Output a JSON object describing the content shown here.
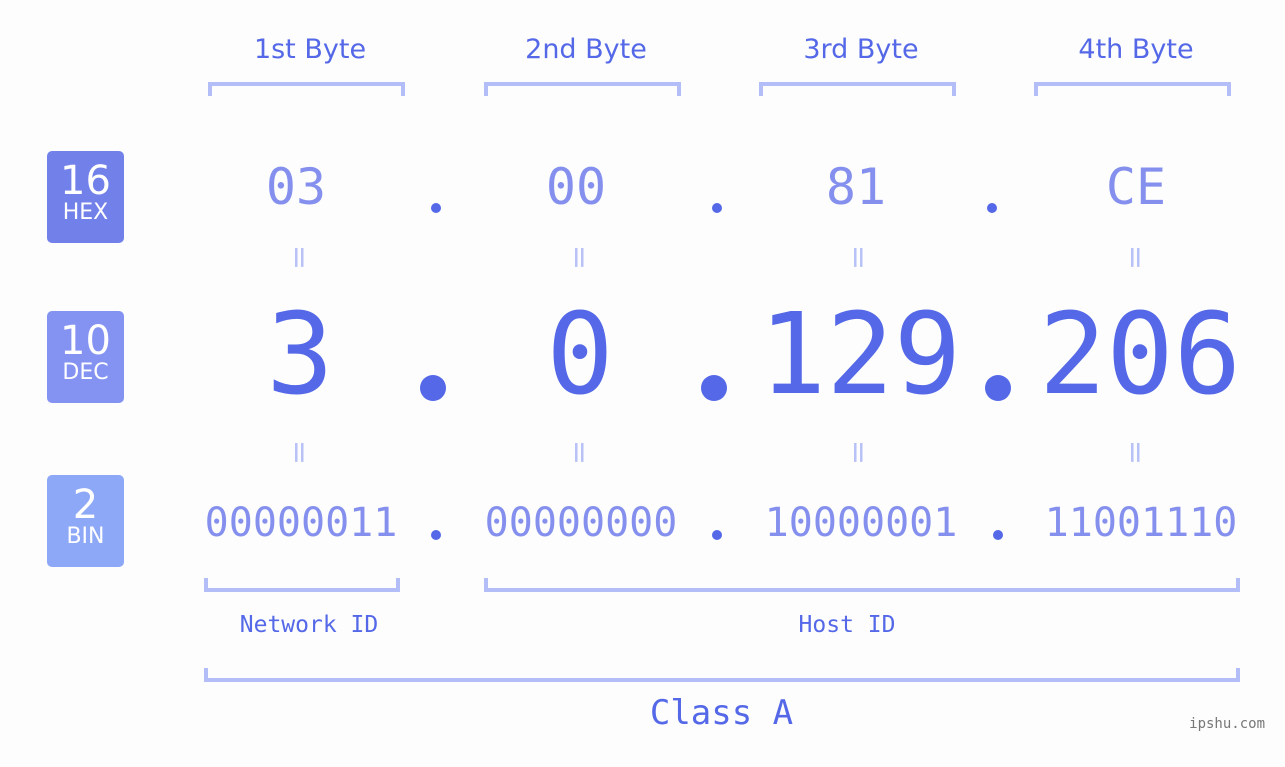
{
  "bases": [
    {
      "num": "16",
      "label": "HEX",
      "color": "#7280ea"
    },
    {
      "num": "10",
      "label": "DEC",
      "color": "#8492f2"
    },
    {
      "num": "2",
      "label": "BIN",
      "color": "#8ea8f8"
    }
  ],
  "byte_headers": [
    "1st Byte",
    "2nd Byte",
    "3rd Byte",
    "4th Byte"
  ],
  "hex": [
    "03",
    "00",
    "81",
    "CE"
  ],
  "dec": [
    "3",
    "0",
    "129",
    "206"
  ],
  "bin": [
    "00000011",
    "00000000",
    "10000001",
    "11001110"
  ],
  "equals_sign": "=",
  "network_id_label": "Network ID",
  "host_id_label": "Host ID",
  "class_label": "Class A",
  "watermark": "ipshu.com"
}
